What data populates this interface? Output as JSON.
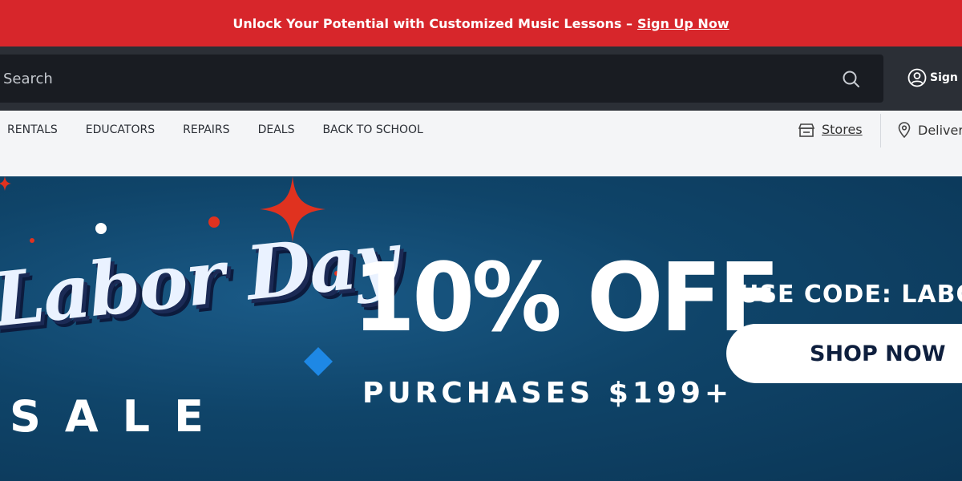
{
  "promo": {
    "text": "Unlock Your Potential with Customized Music Lessons –",
    "link": "Sign Up Now",
    "color": "#d7262b"
  },
  "header": {
    "search_placeholder": "Search",
    "search_icon": "search-icon",
    "signin_label": "Sign In",
    "signin_icon": "user-circle-icon"
  },
  "nav": {
    "links": [
      "RENTALS",
      "EDUCATORS",
      "REPAIRS",
      "DEALS",
      "BACK TO SCHOOL"
    ],
    "stores_label": "Stores",
    "stores_icon": "store-icon",
    "deliver_label": "Deliver",
    "deliver_icon": "location-pin-icon"
  },
  "hero": {
    "script_title": "Labor Day",
    "sale_word": "SALE",
    "offer": "10% OFF",
    "offer_sub": "PURCHASES $199+",
    "code_line": "USE CODE: LABOR",
    "button": "SHOP NOW",
    "background_color": "#0f4469",
    "accent_red": "#e0321f",
    "accent_blue": "#1e88e5"
  }
}
